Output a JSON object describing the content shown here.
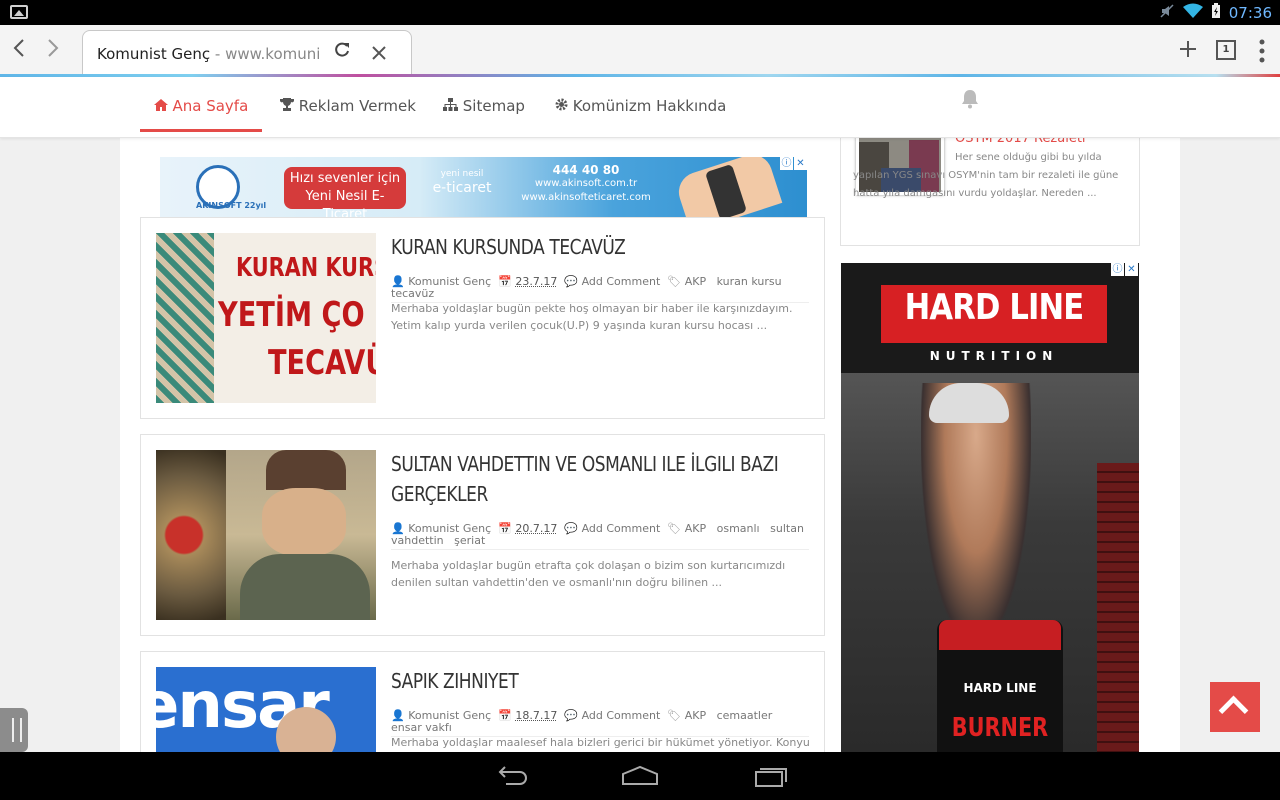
{
  "status_bar": {
    "time": "07:36"
  },
  "browser": {
    "tab_title": "Komunist Genç",
    "tab_url_sep": " - ",
    "tab_url": "www.komunistgenc.com",
    "open_tabs_count": "1"
  },
  "site_nav": {
    "items": [
      {
        "label": "Ana Sayfa",
        "icon": "home-icon"
      },
      {
        "label": "Reklam Vermek",
        "icon": "trophy-icon"
      },
      {
        "label": "Sitemap",
        "icon": "sitemap-icon"
      },
      {
        "label": "Komünizm Hakkında",
        "icon": "gear-icon"
      }
    ]
  },
  "ad_top": {
    "pill_line1": "Hızı sevenler için",
    "pill_line2": "Yeni Nesil E-Ticaret",
    "etic_line1": "yeni nesil",
    "etic_line2": "e-ticaret",
    "phone": "444 40 80",
    "url1": "www.akinsoft.com.tr",
    "url2": "www.akinsofteticaret.com",
    "logo_text": "AKINSOFT 22yıl"
  },
  "posts": [
    {
      "title": "KURAN KURSUNDA TECAVÜZ",
      "author": "Komunist Genç",
      "date": "23.7.17",
      "comments": "Add Comment",
      "tags": [
        "AKP",
        "kuran kursu",
        "tecavüz"
      ],
      "excerpt": "Merhaba yoldaşlar bugün pekte hoş olmayan bir haber ile karşınızdayım. Yetim kalıp yurda verilen çocuk(U.P) 9 yaşında kuran kursu hocası ...",
      "thumb_lines": [
        "KURAN KURS",
        "YETİM ÇO",
        "TECAVÜ"
      ]
    },
    {
      "title": "SULTAN VAHDETTIN VE OSMANLI ILE İLGILI BAZI GERÇEKLER",
      "author": "Komunist Genç",
      "date": "20.7.17",
      "comments": "Add Comment",
      "tags": [
        "AKP",
        "osmanlı",
        "sultan vahdettin",
        "şeriat"
      ],
      "excerpt": "Merhaba yoldaşlar bugün etrafta çok dolaşan o bizim son kurtarıcımızdı denilen sultan vahdettin'den ve osmanlı'nın doğru bilinen ..."
    },
    {
      "title": "SAPIK ZIHNIYET",
      "author": "Komunist Genç",
      "date": "18.7.17",
      "comments": "Add Comment",
      "tags": [
        "AKP",
        "cemaatler",
        "ensar vakfı"
      ],
      "excerpt": "Merhaba yoldaşlar maalesef hala bizleri gerici bir hükümet yönetiyor. Konyuda bu",
      "thumb_text": "ensar"
    }
  ],
  "sidebar": {
    "recent": {
      "title": "OSYM 2017 Rezaleti",
      "text": "Her sene olduğu gibi bu yılda yapılan YGS sınavı OSYM'nin tam bir rezaleti ile güne hatta yıla damgasını vurdu yoldaşlar. Nereden ..."
    },
    "ad": {
      "brand": "HARD LINE",
      "sub": "NUTRITION",
      "product_brand": "HARD LINE",
      "product": "BURNER"
    }
  },
  "colors": {
    "accent": "#e44b48",
    "status_blue": "#6fb8ff"
  }
}
